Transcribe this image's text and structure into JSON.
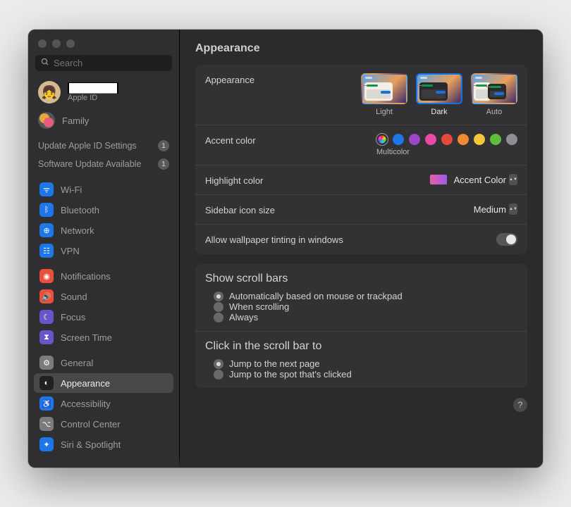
{
  "title": "Appearance",
  "search": {
    "placeholder": "Search"
  },
  "account": {
    "name_redacted": "████████",
    "sub": "Apple ID",
    "family": "Family"
  },
  "alerts": [
    {
      "label": "Update Apple ID Settings",
      "badge": "1"
    },
    {
      "label": "Software Update Available",
      "badge": "1"
    }
  ],
  "sidebar_groups": [
    [
      {
        "label": "Wi-Fi",
        "color": "#1d77e6",
        "glyph": "ᯤ"
      },
      {
        "label": "Bluetooth",
        "color": "#1d77e6",
        "glyph": "ᛒ"
      },
      {
        "label": "Network",
        "color": "#1d77e6",
        "glyph": "⊕"
      },
      {
        "label": "VPN",
        "color": "#1d77e6",
        "glyph": "☷"
      }
    ],
    [
      {
        "label": "Notifications",
        "color": "#e9503c",
        "glyph": "◉"
      },
      {
        "label": "Sound",
        "color": "#e9503c",
        "glyph": "🔊"
      },
      {
        "label": "Focus",
        "color": "#6a55c8",
        "glyph": "☾"
      },
      {
        "label": "Screen Time",
        "color": "#6a55c8",
        "glyph": "⧗"
      }
    ],
    [
      {
        "label": "General",
        "color": "#7b7b7e",
        "glyph": "⚙"
      },
      {
        "label": "Appearance",
        "color": "#202022",
        "glyph": "◐",
        "active": true
      },
      {
        "label": "Accessibility",
        "color": "#1d77e6",
        "glyph": "♿"
      },
      {
        "label": "Control Center",
        "color": "#7b7b7e",
        "glyph": "⌥"
      },
      {
        "label": "Siri & Spotlight",
        "color": "#1d77e6",
        "glyph": "✦"
      }
    ]
  ],
  "appearance_row": {
    "label": "Appearance",
    "options": [
      {
        "caption": "Light"
      },
      {
        "caption": "Dark",
        "selected": true
      },
      {
        "caption": "Auto"
      }
    ]
  },
  "accent_row": {
    "label": "Accent color",
    "sub": "Multicolor",
    "colors": [
      "#1d77e6",
      "#9d46c8",
      "#e84aa6",
      "#e5493a",
      "#ef8b2e",
      "#f3c63c",
      "#5ebf3d",
      "#8e8e93"
    ]
  },
  "highlight_row": {
    "label": "Highlight color",
    "value": "Accent Color"
  },
  "sidebar_size_row": {
    "label": "Sidebar icon size",
    "value": "Medium"
  },
  "tinting_row": {
    "label": "Allow wallpaper tinting in windows",
    "on": true
  },
  "scrollbars": {
    "title": "Show scroll bars",
    "options": [
      {
        "label": "Automatically based on mouse or trackpad",
        "on": true
      },
      {
        "label": "When scrolling",
        "on": false
      },
      {
        "label": "Always",
        "on": false
      }
    ]
  },
  "click_scroll": {
    "title": "Click in the scroll bar to",
    "options": [
      {
        "label": "Jump to the next page",
        "on": true
      },
      {
        "label": "Jump to the spot that's clicked",
        "on": false
      }
    ]
  },
  "help": "?"
}
